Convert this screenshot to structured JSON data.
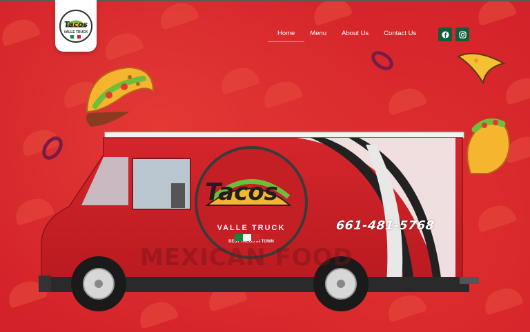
{
  "brand": {
    "name_line1": "Tacos",
    "name_line2": "VALLE TRUCK",
    "tagline": "BEST TACOS IN TOWN"
  },
  "nav": {
    "items": [
      {
        "label": "Home",
        "active": true
      },
      {
        "label": "Menu",
        "active": false
      },
      {
        "label": "About Us",
        "active": false
      },
      {
        "label": "Contact Us",
        "active": false
      }
    ]
  },
  "social": [
    {
      "icon": "facebook-icon"
    },
    {
      "icon": "instagram-icon"
    }
  ],
  "hero": {
    "phone": "661-481-5768",
    "side_text": "MEXICAN FOOD"
  },
  "colors": {
    "background": "#d3222a",
    "truck_body": "#cf2026",
    "social_bg": "#0d5f3c",
    "taco_shell": "#f6b52e",
    "lettuce": "#6fbe3a"
  }
}
